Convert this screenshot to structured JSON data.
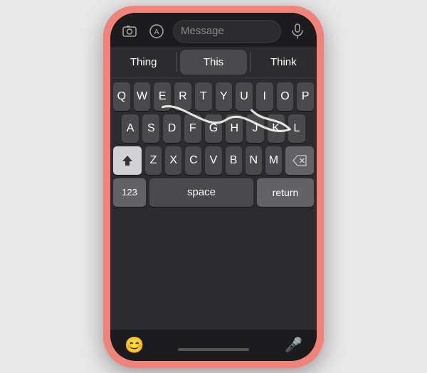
{
  "phone": {
    "top_bar": {
      "camera_icon": "📷",
      "app_icon": "🅐",
      "message_placeholder": "Message",
      "mic_icon": "🎤"
    },
    "autocomplete": {
      "left": "Thing",
      "center": "This",
      "right": "Think"
    },
    "keyboard": {
      "row1": [
        "Q",
        "W",
        "E",
        "R",
        "T",
        "Y",
        "U",
        "I",
        "O",
        "P"
      ],
      "row2": [
        "A",
        "S",
        "D",
        "F",
        "G",
        "H",
        "J",
        "K",
        "L"
      ],
      "row3": [
        "Z",
        "X",
        "C",
        "V",
        "B",
        "N",
        "M"
      ],
      "shift_label": "⇧",
      "backspace_label": "⌫",
      "numbers_label": "123",
      "space_label": "space",
      "return_label": "return"
    },
    "bottom_bar": {
      "emoji_icon": "😊",
      "mic_icon": "🎤"
    }
  }
}
